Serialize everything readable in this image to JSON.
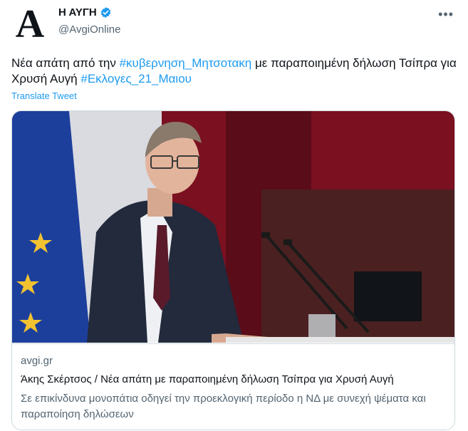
{
  "author": {
    "avatar_letter": "A",
    "display_name": "Η ΑΥΓΗ",
    "handle": "@AvgiOnline",
    "verified": true
  },
  "tweet": {
    "text_1": "Νέα απάτη από την ",
    "hashtag_1": "#κυβερνηση_Μητσοτακη",
    "text_2": " με παραποιημένη δήλωση Τσίπρα για Χρυσή Αυγή ",
    "hashtag_2": "#Εκλογες_21_Μαιου",
    "translate_label": "Translate Tweet"
  },
  "card": {
    "domain": "avgi.gr",
    "title": "Άκης Σκέρτσος / Νέα απάτη με παραποιημένη δήλωση Τσίπρα για Χρυσή Αυγή",
    "description": "Σε επικίνδυνα μονοπάτια οδηγεί την προεκλογική περίοδο η ΝΔ με συνεχή ψέματα και παραποίηση δηλώσεων"
  },
  "colors": {
    "accent": "#1d9bf0",
    "secondary_text": "#536471",
    "border": "#cfd9de"
  },
  "icons": {
    "more": "more-icon",
    "verified": "verified-badge-icon"
  }
}
